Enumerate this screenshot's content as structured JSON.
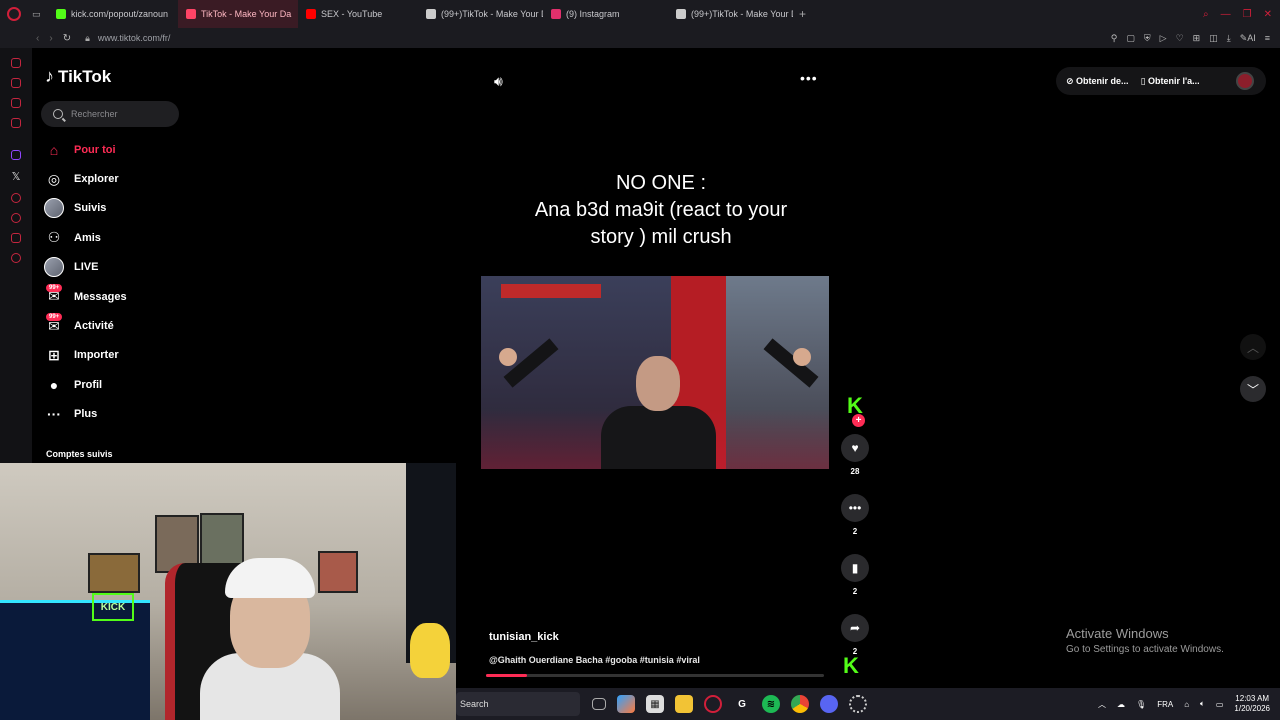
{
  "browser": {
    "tabs": [
      {
        "title": "kick.com/popout/zanoun",
        "color": "#53fc18",
        "active": false
      },
      {
        "title": "TikTok - Make Your Da",
        "color": "#ff4466",
        "active": true
      },
      {
        "title": "SEX - YouTube",
        "color": "#ff0000",
        "active": false
      },
      {
        "title": "(99+)TikTok - Make Your D",
        "color": "#cccccc",
        "active": false
      },
      {
        "title": "(9) Instagram",
        "color": "#e1306c",
        "active": false
      },
      {
        "title": "(99+)TikTok - Make Your D",
        "color": "#cccccc",
        "active": false
      }
    ],
    "url": "www.tiktok.com/fr/"
  },
  "tiktok": {
    "logo": "TikTok",
    "search_placeholder": "Rechercher",
    "nav": [
      {
        "label": "Pour toi",
        "icon": "home-icon",
        "active": true
      },
      {
        "label": "Explorer",
        "icon": "compass-icon"
      },
      {
        "label": "Suivis",
        "icon": "avatar"
      },
      {
        "label": "Amis",
        "icon": "friends-icon"
      },
      {
        "label": "LIVE",
        "icon": "avatar"
      },
      {
        "label": "Messages",
        "icon": "messages-icon",
        "badge": "99+"
      },
      {
        "label": "Activité",
        "icon": "activity-icon",
        "badge": "99+"
      },
      {
        "label": "Importer",
        "icon": "upload-icon"
      },
      {
        "label": "Profil",
        "icon": "profile-icon"
      },
      {
        "label": "Plus",
        "icon": "more-icon"
      }
    ],
    "following_title": "Comptes suivis",
    "caption_lines": [
      "NO ONE :",
      "Ana b3d ma9it (react to your",
      "story ) mil crush"
    ],
    "username": "tunisian_kick",
    "description": "@Ghaith Ouerdiane Bacha #gooba #tunisia #viral",
    "progress": 0.12,
    "actions": {
      "likes": "28",
      "comments": "2",
      "saves": "2",
      "shares": "2"
    },
    "top_right": {
      "btn1": "Obtenir de...",
      "btn2": "Obtenir l'a..."
    }
  },
  "activate": {
    "title": "Activate Windows",
    "subtitle": "Go to Settings to activate Windows."
  },
  "taskbar": {
    "search": "Search",
    "lang": "FRA",
    "time": "12:03 AM",
    "date": "1/20/2026"
  }
}
